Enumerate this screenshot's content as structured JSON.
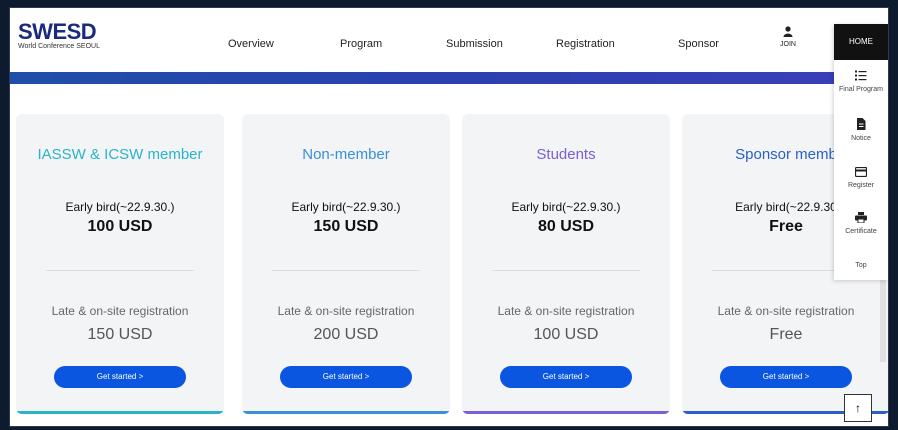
{
  "header": {
    "logo_main": "SWESD",
    "logo_sub": "World Conference SEOUL",
    "nav": [
      "Overview",
      "Program",
      "Submission",
      "Registration",
      "Sponsor"
    ],
    "join_icon": "person-icon",
    "join_label": "JOIN"
  },
  "sidebar": {
    "home": "HOME",
    "items": [
      {
        "label": "Final Program",
        "icon": "list-icon"
      },
      {
        "label": "Notice",
        "icon": "document-icon"
      },
      {
        "label": "Register",
        "icon": "card-icon"
      },
      {
        "label": "Certificate",
        "icon": "printer-icon"
      },
      {
        "label": "Top",
        "icon": ""
      }
    ]
  },
  "cards": [
    {
      "title": "IASSW & ICSW member",
      "title_color": "#2ab3c9",
      "early_label": "Early bird(~22.9.30.)",
      "early_price": "100 USD",
      "late_label": "Late & on-site registration",
      "late_price": "150 USD",
      "button": "Get started >",
      "accent": "#2ab3c9"
    },
    {
      "title": "Non-member",
      "title_color": "#3a8fd8",
      "early_label": "Early bird(~22.9.30.)",
      "early_price": "150 USD",
      "late_label": "Late & on-site registration",
      "late_price": "200 USD",
      "button": "Get started >",
      "accent": "#3a8fd8"
    },
    {
      "title": "Students",
      "title_color": "#7a5fd6",
      "early_label": "Early bird(~22.9.30.)",
      "early_price": "80 USD",
      "late_label": "Late & on-site registration",
      "late_price": "100 USD",
      "button": "Get started >",
      "accent": "#7a5fd6"
    },
    {
      "title": "Sponsor memb",
      "title_color": "#2a5fc8",
      "early_label": "Early bird(~22.9.30",
      "early_price": "Free",
      "late_label": "Late & on-site registration",
      "late_price": "Free",
      "button": "Get started >",
      "accent": "#2a5fc8"
    }
  ],
  "scroll_top_icon": "arrow-up-icon",
  "scroll_top_glyph": "↑"
}
